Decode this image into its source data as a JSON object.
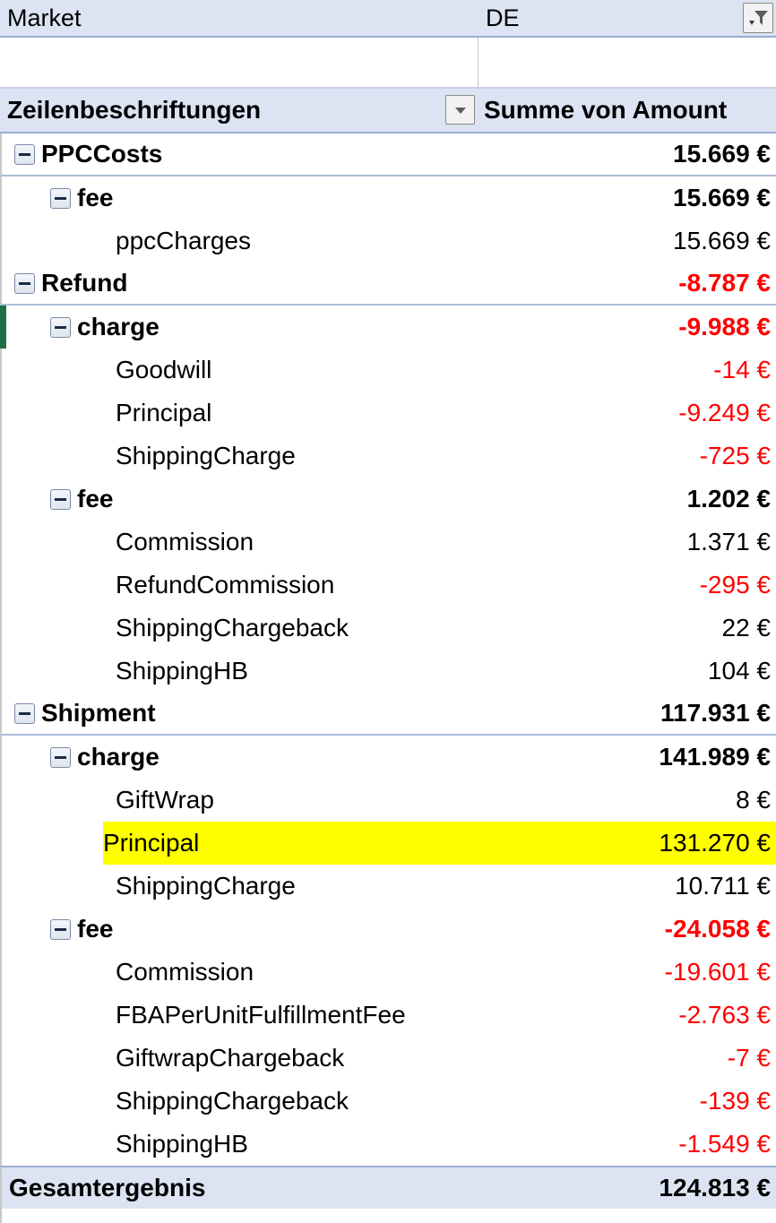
{
  "filter": {
    "field_label": "Market",
    "selected_value": "DE",
    "filter_icon": "funnel-filter-icon"
  },
  "column_headers": {
    "row_labels": "Zeilenbeschriftungen",
    "value_header": "Summe von Amount",
    "dropdown_icon": "chevron-down-icon"
  },
  "colors": {
    "header_bg": "#dce3f2",
    "header_border": "#9aaed4",
    "negative_text": "#ff0000",
    "highlight_bg": "#ffff00",
    "marker_green": "#1e7145"
  },
  "rows": [
    {
      "label": "PPCCosts",
      "value": "15.669 €",
      "level": 0,
      "negative": false,
      "collapsible": true,
      "highlight": false,
      "separator": true,
      "marker": false
    },
    {
      "label": "fee",
      "value": "15.669 €",
      "level": 1,
      "negative": false,
      "collapsible": true,
      "highlight": false,
      "separator": false,
      "marker": false
    },
    {
      "label": "ppcCharges",
      "value": "15.669 €",
      "level": 2,
      "negative": false,
      "collapsible": false,
      "highlight": false,
      "separator": false,
      "marker": false
    },
    {
      "label": "Refund",
      "value": "-8.787 €",
      "level": 0,
      "negative": true,
      "collapsible": true,
      "highlight": false,
      "separator": true,
      "marker": false
    },
    {
      "label": "charge",
      "value": "-9.988 €",
      "level": 1,
      "negative": true,
      "collapsible": true,
      "highlight": false,
      "separator": false,
      "marker": true
    },
    {
      "label": "Goodwill",
      "value": "-14 €",
      "level": 2,
      "negative": true,
      "collapsible": false,
      "highlight": false,
      "separator": false,
      "marker": false
    },
    {
      "label": "Principal",
      "value": "-9.249 €",
      "level": 2,
      "negative": true,
      "collapsible": false,
      "highlight": false,
      "separator": false,
      "marker": false
    },
    {
      "label": "ShippingCharge",
      "value": "-725 €",
      "level": 2,
      "negative": true,
      "collapsible": false,
      "highlight": false,
      "separator": false,
      "marker": false
    },
    {
      "label": "fee",
      "value": "1.202 €",
      "level": 1,
      "negative": false,
      "collapsible": true,
      "highlight": false,
      "separator": false,
      "marker": false
    },
    {
      "label": "Commission",
      "value": "1.371 €",
      "level": 2,
      "negative": false,
      "collapsible": false,
      "highlight": false,
      "separator": false,
      "marker": false
    },
    {
      "label": "RefundCommission",
      "value": "-295 €",
      "level": 2,
      "negative": true,
      "collapsible": false,
      "highlight": false,
      "separator": false,
      "marker": false
    },
    {
      "label": "ShippingChargeback",
      "value": "22 €",
      "level": 2,
      "negative": false,
      "collapsible": false,
      "highlight": false,
      "separator": false,
      "marker": false
    },
    {
      "label": "ShippingHB",
      "value": "104 €",
      "level": 2,
      "negative": false,
      "collapsible": false,
      "highlight": false,
      "separator": false,
      "marker": false
    },
    {
      "label": "Shipment",
      "value": "117.931 €",
      "level": 0,
      "negative": false,
      "collapsible": true,
      "highlight": false,
      "separator": true,
      "marker": false
    },
    {
      "label": "charge",
      "value": "141.989 €",
      "level": 1,
      "negative": false,
      "collapsible": true,
      "highlight": false,
      "separator": false,
      "marker": false
    },
    {
      "label": "GiftWrap",
      "value": "8 €",
      "level": 2,
      "negative": false,
      "collapsible": false,
      "highlight": false,
      "separator": false,
      "marker": false
    },
    {
      "label": "Principal",
      "value": "131.270 €",
      "level": 2,
      "negative": false,
      "collapsible": false,
      "highlight": true,
      "separator": false,
      "marker": false
    },
    {
      "label": "ShippingCharge",
      "value": "10.711 €",
      "level": 2,
      "negative": false,
      "collapsible": false,
      "highlight": false,
      "separator": false,
      "marker": false
    },
    {
      "label": "fee",
      "value": "-24.058 €",
      "level": 1,
      "negative": true,
      "collapsible": true,
      "highlight": false,
      "separator": false,
      "marker": false
    },
    {
      "label": "Commission",
      "value": "-19.601 €",
      "level": 2,
      "negative": true,
      "collapsible": false,
      "highlight": false,
      "separator": false,
      "marker": false
    },
    {
      "label": "FBAPerUnitFulfillmentFee",
      "value": "-2.763 €",
      "level": 2,
      "negative": true,
      "collapsible": false,
      "highlight": false,
      "separator": false,
      "marker": false
    },
    {
      "label": "GiftwrapChargeback",
      "value": "-7 €",
      "level": 2,
      "negative": true,
      "collapsible": false,
      "highlight": false,
      "separator": false,
      "marker": false
    },
    {
      "label": "ShippingChargeback",
      "value": "-139 €",
      "level": 2,
      "negative": true,
      "collapsible": false,
      "highlight": false,
      "separator": false,
      "marker": false
    },
    {
      "label": "ShippingHB",
      "value": "-1.549 €",
      "level": 2,
      "negative": true,
      "collapsible": false,
      "highlight": false,
      "separator": false,
      "marker": false
    }
  ],
  "grand_total": {
    "label": "Gesamtergebnis",
    "value": "124.813 €"
  }
}
